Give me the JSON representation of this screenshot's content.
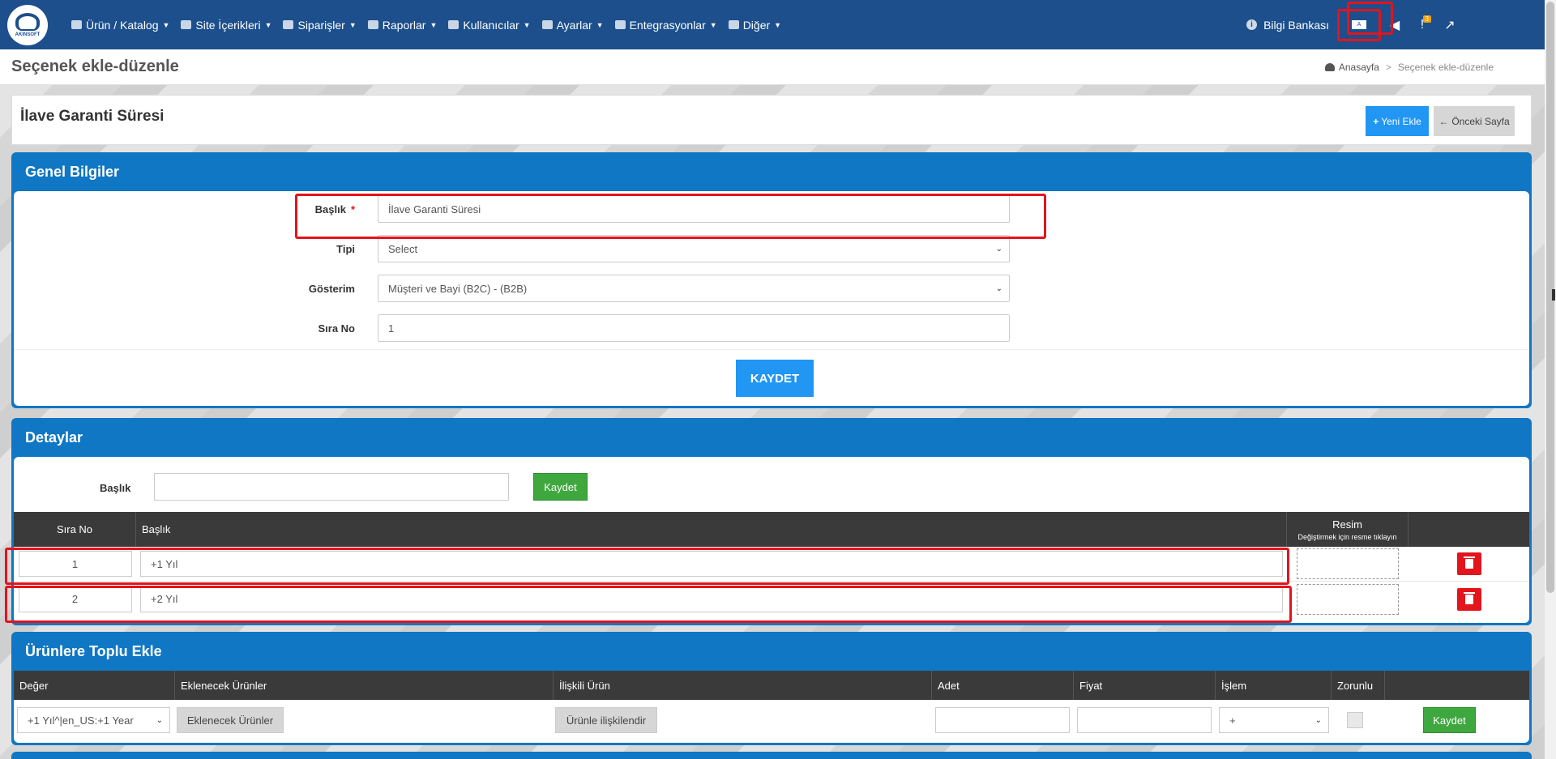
{
  "nav": {
    "logo_text": "AKINSOFT",
    "menu": [
      {
        "label": "Ürün / Katalog",
        "icon": "cubes-icon"
      },
      {
        "label": "Site İçerikleri",
        "icon": "pages-icon"
      },
      {
        "label": "Siparişler",
        "icon": "truck-icon"
      },
      {
        "label": "Raporlar",
        "icon": "report-icon"
      },
      {
        "label": "Kullanıcılar",
        "icon": "users-icon"
      },
      {
        "label": "Ayarlar",
        "icon": "gears-icon"
      },
      {
        "label": "Entegrasyonlar",
        "icon": "sitemap-icon"
      },
      {
        "label": "Diğer",
        "icon": "grid-icon"
      }
    ],
    "knowledge_base": "Bilgi Bankası",
    "info_glyph": "i",
    "language_glyph": "A",
    "alerts_badge": "3",
    "alerts_glyph": "!",
    "megaphone_glyph": "◀",
    "external_glyph": "↗"
  },
  "page": {
    "title": "Seçenek ekle-düzenle",
    "breadcrumb_home": "Anasayfa",
    "breadcrumb_sep": ">",
    "breadcrumb_current": "Seçenek ekle-düzenle"
  },
  "header_card": {
    "title": "İlave Garanti Süresi",
    "new_button": "Yeni Ekle",
    "new_glyph": "+",
    "back_button": "Önceki Sayfa",
    "back_glyph": "←"
  },
  "general": {
    "title": "Genel Bilgiler",
    "baslik_label": "Başlık",
    "required_mark": "*",
    "baslik_value": "İlave Garanti Süresi",
    "tipi_label": "Tipi",
    "tipi_value": "Select",
    "gosterim_label": "Gösterim",
    "gosterim_value": "Müşteri ve Bayi (B2C) - (B2B)",
    "sira_label": "Sıra No",
    "sira_value": "1",
    "save_button": "KAYDET",
    "select_arrow": "⌄"
  },
  "details": {
    "title": "Detaylar",
    "baslik_label": "Başlık",
    "baslik_value": "",
    "save_button": "Kaydet",
    "columns": {
      "sira": "Sıra No",
      "baslik": "Başlık",
      "resim": "Resim",
      "resim_hint": "Değiştirmek için resme tıklayın"
    },
    "rows": [
      {
        "sira": "1",
        "baslik": "+1 Yıl"
      },
      {
        "sira": "2",
        "baslik": "+2 Yıl"
      }
    ]
  },
  "bulk": {
    "title": "Ürünlere Toplu Ekle",
    "columns": [
      "Değer",
      "Eklenecek Ürünler",
      "İlişkili Ürün",
      "Adet",
      "Fiyat",
      "İşlem",
      "Zorunlu"
    ],
    "deger_value": "+1 Yıl^|en_US:+1 Year",
    "products_button": "Eklenecek Ürünler",
    "related_button": "Ürünle ilişkilendir",
    "adet_value": "",
    "fiyat_value": "",
    "islem_value": "+",
    "save_button": "Kaydet",
    "select_arrow": "⌄"
  },
  "colors": {
    "navbar": "#1c4f8c",
    "panel": "#0f77c4",
    "primary_button": "#2196f3",
    "success_button": "#3ea83f",
    "danger": "#e3141b",
    "table_header": "#3a3a3a"
  }
}
